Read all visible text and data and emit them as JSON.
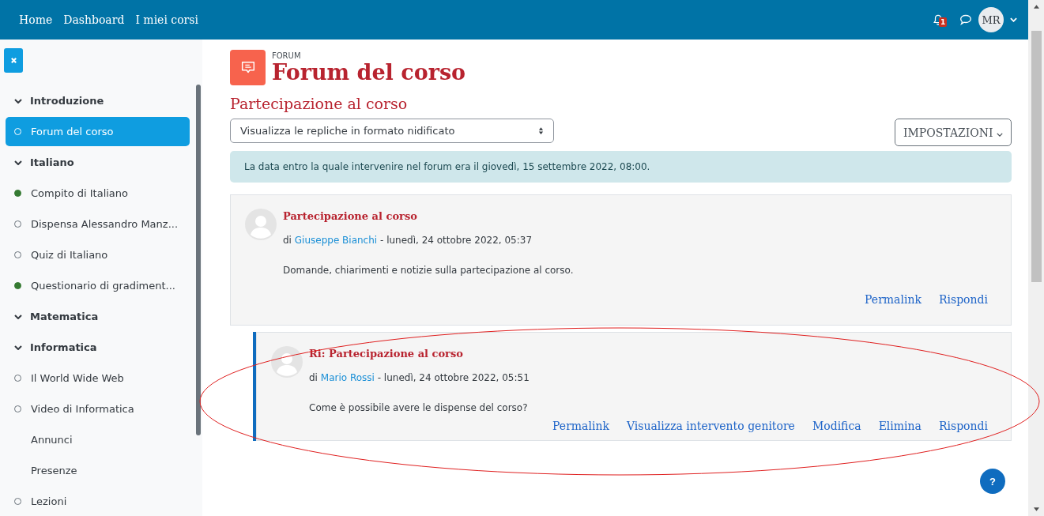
{
  "nav": {
    "links": [
      "Home",
      "Dashboard",
      "I miei corsi"
    ],
    "notification_count": "1",
    "avatar": "MR"
  },
  "sidebar": {
    "items": [
      {
        "kind": "section",
        "label": "Introduzione",
        "selected": false
      },
      {
        "kind": "activity",
        "label": "Forum del corso",
        "completed": false,
        "selected": true
      },
      {
        "kind": "section",
        "label": "Italiano",
        "selected": false
      },
      {
        "kind": "activity",
        "label": "Compito di Italiano",
        "completed": true,
        "selected": false
      },
      {
        "kind": "activity",
        "label": "Dispensa Alessandro Manz...",
        "completed": false,
        "selected": false
      },
      {
        "kind": "activity",
        "label": "Quiz di Italiano",
        "completed": false,
        "selected": false
      },
      {
        "kind": "activity",
        "label": "Questionario di gradiment...",
        "completed": true,
        "selected": false
      },
      {
        "kind": "section",
        "label": "Matematica",
        "selected": false
      },
      {
        "kind": "section",
        "label": "Informatica",
        "selected": false
      },
      {
        "kind": "activity",
        "label": "Il World Wide Web",
        "completed": false,
        "selected": false
      },
      {
        "kind": "activity",
        "label": "Video di Informatica",
        "completed": false,
        "selected": false
      },
      {
        "kind": "plain",
        "label": "Annunci",
        "selected": false
      },
      {
        "kind": "plain",
        "label": "Presenze",
        "selected": false
      },
      {
        "kind": "activity",
        "label": "Lezioni",
        "completed": false,
        "selected": false
      }
    ]
  },
  "header": {
    "eyebrow": "FORUM",
    "title": "Forum del corso"
  },
  "discussion_title": "Partecipazione al corso",
  "display_select": {
    "value": "Visualizza le repliche in formato nidificato"
  },
  "settings_button": "IMPOSTAZIONI",
  "notice": "La data entro la quale intervenire nel forum era il giovedì, 15 settembre 2022, 08:00.",
  "posts": [
    {
      "reply": false,
      "subject": "Partecipazione al corso",
      "by": "di",
      "author": "Giuseppe Bianchi",
      "date": "- lunedì, 24 ottobre 2022, 05:37",
      "message": "Domande, chiarimenti e notizie sulla partecipazione al corso.",
      "actions": [
        "Permalink",
        "Rispondi"
      ]
    },
    {
      "reply": true,
      "subject": "Ri: Partecipazione al corso",
      "by": "di",
      "author": "Mario Rossi",
      "date": "- lunedì, 24 ottobre 2022, 05:51",
      "message": "Come è possibile avere le dispense del corso?",
      "actions": [
        "Permalink",
        "Visualizza intervento genitore",
        "Modifica",
        "Elimina",
        "Rispondi"
      ]
    }
  ],
  "help_button": "?"
}
